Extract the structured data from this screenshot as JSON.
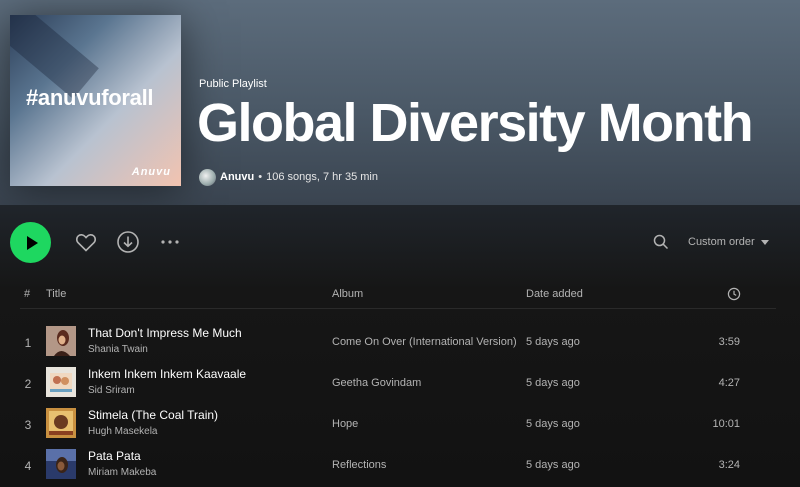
{
  "playlist": {
    "cover_text": "#anuvuforall",
    "cover_brand": "Anuvu",
    "type": "Public Playlist",
    "title": "Global Diversity Month",
    "owner": "Anuvu",
    "separator": "•",
    "stats": "106 songs, 7 hr 35 min"
  },
  "actions": {
    "play_icon": "play-icon",
    "heart_icon": "heart-icon",
    "download_icon": "download-icon",
    "more_icon": "more-icon",
    "search_icon": "search-icon",
    "sort_label": "Custom order",
    "accent_color": "#1ed760"
  },
  "columns": {
    "num": "#",
    "title": "Title",
    "album": "Album",
    "date_added": "Date added",
    "duration_icon": "clock-icon"
  },
  "tracks": [
    {
      "num": "1",
      "title": "That Don't Impress Me Much",
      "artist": "Shania Twain",
      "album": "Come On Over (International Version)",
      "date_added": "5 days ago",
      "duration": "3:59"
    },
    {
      "num": "2",
      "title": "Inkem Inkem Inkem Kaavaale",
      "artist": "Sid Sriram",
      "album": "Geetha Govindam",
      "date_added": "5 days ago",
      "duration": "4:27"
    },
    {
      "num": "3",
      "title": "Stimela (The Coal Train)",
      "artist": "Hugh Masekela",
      "album": "Hope",
      "date_added": "5 days ago",
      "duration": "10:01"
    },
    {
      "num": "4",
      "title": "Pata Pata",
      "artist": "Miriam Makeba",
      "album": "Reflections",
      "date_added": "5 days ago",
      "duration": "3:24"
    }
  ]
}
